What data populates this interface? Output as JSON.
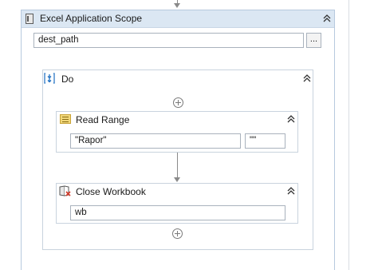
{
  "excel_scope": {
    "title": "Excel Application Scope",
    "path_value": "dest_path",
    "browse_label": "...",
    "collapse_glyph": "⌃⌃"
  },
  "do_sequence": {
    "title": "Do",
    "collapse_glyph": "⌃⌃"
  },
  "read_range": {
    "title": "Read Range",
    "sheet_value": "\"Rapor\"",
    "range_value": "\"\"",
    "collapse_glyph": "⌃⌃"
  },
  "close_workbook": {
    "title": "Close Workbook",
    "workbook_value": "wb",
    "collapse_glyph": "⌃⌃"
  },
  "icons": {
    "scope": "excel-scope-icon",
    "sequence": "sequence-icon",
    "read_range": "read-range-icon",
    "close_workbook": "close-workbook-icon",
    "collapse": "double-chevron-up-icon",
    "add": "add-activity-icon"
  },
  "colors": {
    "border": "#b7c9de",
    "scope_header": "#dbe7f3",
    "sequence_icon": "#1e6fc2",
    "read_range_icon": "#d9b342",
    "close_icon_red": "#d23a2a"
  }
}
